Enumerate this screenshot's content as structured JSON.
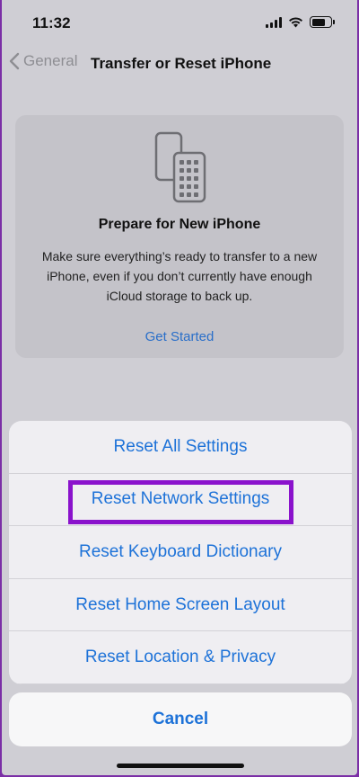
{
  "status_bar": {
    "time": "11:32"
  },
  "nav": {
    "back_label": "General",
    "title": "Transfer or Reset iPhone"
  },
  "card": {
    "title": "Prepare for New iPhone",
    "description": "Make sure everything’s ready to transfer to a new iPhone, even if you don’t currently have enough iCloud storage to back up.",
    "link": "Get Started",
    "icon": "transfer-phones-icon"
  },
  "sheet": {
    "items": [
      {
        "label": "Reset All Settings"
      },
      {
        "label": "Reset Network Settings"
      },
      {
        "label": "Reset Keyboard Dictionary"
      },
      {
        "label": "Reset Home Screen Layout"
      },
      {
        "label": "Reset Location & Privacy"
      }
    ],
    "cancel_label": "Cancel"
  },
  "colors": {
    "accent": "#1d72d8",
    "highlight_border": "#8a12cc"
  }
}
